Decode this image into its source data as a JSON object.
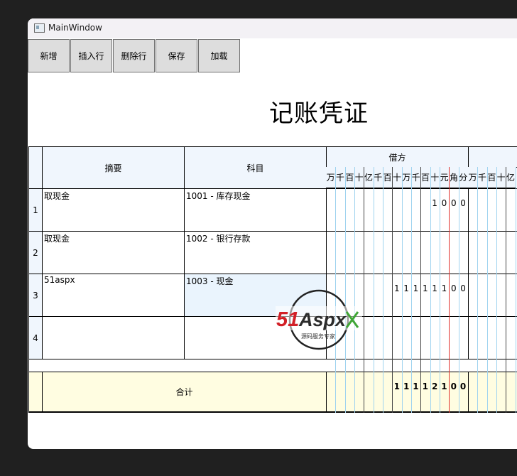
{
  "window": {
    "title": "MainWindow"
  },
  "toolbar": {
    "buttons": [
      "新增",
      "插入行",
      "删除行",
      "保存",
      "加载"
    ]
  },
  "document": {
    "title": "记账凭证"
  },
  "table": {
    "headers": {
      "summary": "摘要",
      "subject": "科目",
      "debit": "借方"
    },
    "digit_units": [
      "万",
      "千",
      "百",
      "十",
      "亿",
      "千",
      "百",
      "十",
      "万",
      "千",
      "百",
      "十",
      "元",
      "角",
      "分"
    ],
    "credit_units_partial": [
      "万",
      "千",
      "百",
      "十",
      "亿"
    ],
    "rows": [
      {
        "no": "1",
        "summary": "取现金",
        "subject": "1001 - 库存现金",
        "debit_digits": [
          "",
          "",
          "",
          "",
          "",
          "",
          "",
          "",
          "",
          "",
          "",
          "1",
          "0",
          "0",
          "0"
        ]
      },
      {
        "no": "2",
        "summary": "取现金",
        "subject": "1002 - 银行存款",
        "debit_digits": [
          "",
          "",
          "",
          "",
          "",
          "",
          "",
          "",
          "",
          "",
          "",
          "",
          "",
          "",
          ""
        ]
      },
      {
        "no": "3",
        "summary": "51aspx",
        "subject": "1003 - 现金",
        "debit_digits": [
          "",
          "",
          "",
          "",
          "",
          "",
          "",
          "1",
          "1",
          "1",
          "1",
          "1",
          "1",
          "0",
          "0"
        ]
      },
      {
        "no": "4",
        "summary": "",
        "subject": "",
        "debit_digits": [
          "",
          "",
          "",
          "",
          "",
          "",
          "",
          "",
          "",
          "",
          "",
          "",
          "",
          "",
          ""
        ]
      }
    ],
    "total": {
      "label": "合计",
      "debit_digits": [
        "",
        "",
        "",
        "",
        "",
        "",
        "",
        "1",
        "1",
        "1",
        "1",
        "2",
        "1",
        "0",
        "0"
      ]
    }
  },
  "watermark": {
    "brand": "51Aspx",
    "tagline": "源码服务专家"
  },
  "colors": {
    "header_bg": "#f0f6fd",
    "total_bg": "#fffde1",
    "red_line": "#e0302a",
    "blue_line": "#9fd3ef",
    "selected_bg": "#eaf4fd"
  }
}
